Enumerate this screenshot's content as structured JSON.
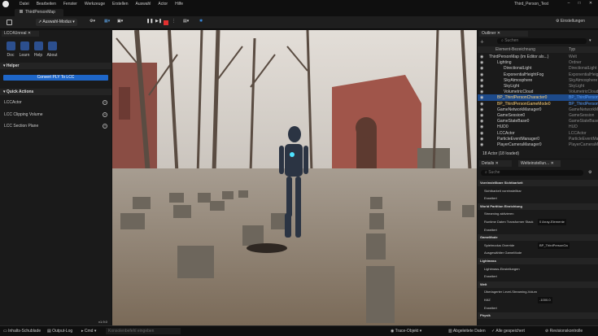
{
  "window": {
    "app_title": "Third_Person_Test"
  },
  "menu": [
    "Datei",
    "Bearbeiten",
    "Fenster",
    "Werkzeuge",
    "Erstellen",
    "Auswahl",
    "Actor",
    "Hilfe"
  ],
  "tab": {
    "label": "ThirdPersonMap"
  },
  "toolbar": {
    "mode_label": "Auswahl-Modus",
    "settings_label": "Einstellungen"
  },
  "left_panel": {
    "tab_label": "LCC4Unreal",
    "icons": [
      "Doc",
      "Learn",
      "Help",
      "About"
    ],
    "helper_header": "Helper",
    "convert_button": "Convert PLY To LCC",
    "quick_actions_header": "Quick Actions",
    "actions": [
      "LCCActor",
      "LCC Clipping Volume",
      "LCC Section Plane"
    ],
    "version": "v1.9.0"
  },
  "outliner": {
    "tab_label": "Outliner",
    "search_placeholder": "Suchen",
    "col_name": "Element-Bezeichnung",
    "col_type": "Typ",
    "items": [
      {
        "name": "ThirdPersonMap (im Editor als...)",
        "type": "Welt"
      },
      {
        "name": "Lighting",
        "type": "Ordner"
      },
      {
        "name": "DirectionalLight",
        "type": "DirectionalLight"
      },
      {
        "name": "ExponentialHeightFog",
        "type": "ExponentialHeight"
      },
      {
        "name": "SkyAtmosphere",
        "type": "SkyAtmosphere"
      },
      {
        "name": "SkyLight",
        "type": "SkyLight"
      },
      {
        "name": "VolumetricCloud",
        "type": "VolumetricCloud"
      },
      {
        "name": "BP_ThirdPersonCharacter0",
        "type": "BP_ThirdPerson"
      },
      {
        "name": "BP_ThirdPersonGameMode0",
        "type": "BP_ThirdPerson"
      },
      {
        "name": "GameNetworkManager0",
        "type": "GameNetworkMan"
      },
      {
        "name": "GameSession0",
        "type": "GameSession"
      },
      {
        "name": "GameStateBase0",
        "type": "GameStateBase"
      },
      {
        "name": "HUD0",
        "type": "HUD"
      },
      {
        "name": "LCCActor",
        "type": "LCCActor"
      },
      {
        "name": "ParticleEventManager0",
        "type": "ParticleEventMan"
      },
      {
        "name": "PlayerCameraManager0",
        "type": "PlayerCameraMan"
      }
    ],
    "footer": "18 Actor (18 loaded)"
  },
  "details": {
    "tab_details": "Details",
    "tab_world": "Welteinstellun...",
    "search_placeholder": "Suche",
    "rows": [
      {
        "label": "Voreinstellbare Sichtbarkeit",
        "value": "",
        "section": true
      },
      {
        "label": "Sichtbarkeit voreinstellbar",
        "value": ""
      },
      {
        "label": "Erweitert",
        "value": ""
      },
      {
        "label": "World Partition Einrichtung",
        "value": "",
        "section": true
      },
      {
        "label": "Streaming aktivieren",
        "value": ""
      },
      {
        "label": "Runtime Daten Transformer Stack",
        "value": "0 Array-Elemente"
      },
      {
        "label": "Erweitert",
        "value": ""
      },
      {
        "label": "GameMode",
        "value": "",
        "section": true
      },
      {
        "label": "Spielmodus Override",
        "value": "BP_ThirdPersonGa"
      },
      {
        "label": "Ausgewählter GameMode",
        "value": ""
      },
      {
        "label": "Lightmass",
        "value": "",
        "section": true
      },
      {
        "label": "Lightmass-Einstellungen",
        "value": ""
      },
      {
        "label": "Erweitert",
        "value": ""
      },
      {
        "label": "Welt",
        "value": "",
        "section": true
      },
      {
        "label": "Überlagerter Level-Streaming-Volum",
        "value": ""
      },
      {
        "label": "KillZ",
        "value": "-1000.0"
      },
      {
        "label": "Erweitert",
        "value": ""
      },
      {
        "label": "Physik",
        "value": "",
        "section": true
      }
    ]
  },
  "statusbar": {
    "items": [
      "Inhalts-Schublade",
      "Output-Log",
      "Cmd",
      "Konsolenbefehl eingeben",
      "Trace-Objekt",
      "Abgeleitete Daten",
      "Alle gespeichert",
      "Revisionskontrolle"
    ]
  }
}
